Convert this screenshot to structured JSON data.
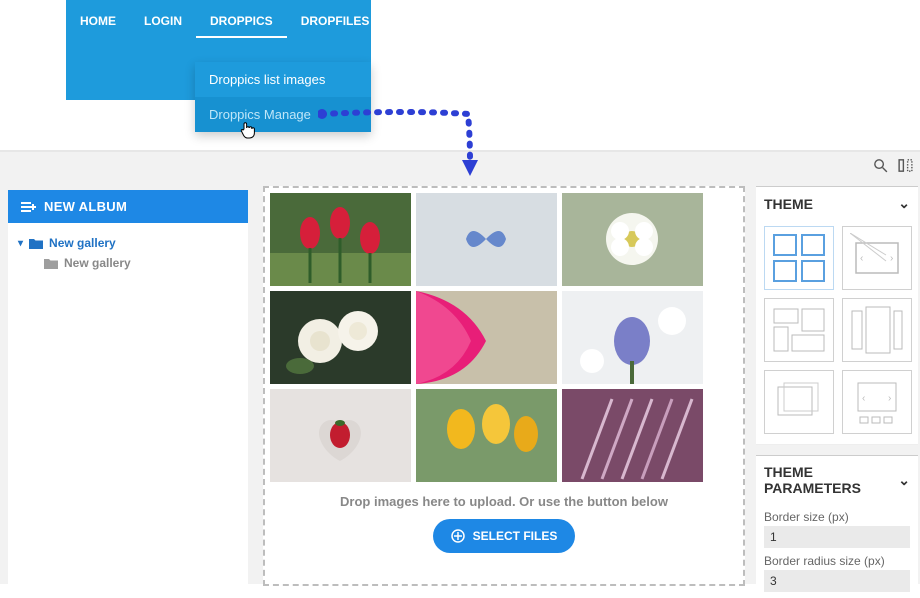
{
  "nav": {
    "items": [
      "HOME",
      "LOGIN",
      "DROPPICS",
      "DROPFILES"
    ],
    "active": "DROPPICS",
    "submenu": [
      "Droppics list images",
      "Droppics Manage"
    ]
  },
  "toolbar": {
    "search_icon": "search-icon",
    "split_icon": "split-icon"
  },
  "sidebar": {
    "new_album": "NEW ALBUM",
    "tree": [
      {
        "label": "New gallery",
        "level": 0,
        "color": "#2072c4"
      },
      {
        "label": "New gallery",
        "level": 1,
        "color": "#888"
      }
    ]
  },
  "gallery": {
    "drop_text": "Drop images here to upload. Or use the button below",
    "select_button": "SELECT FILES",
    "thumbs": [
      "red-tulips",
      "blue-butterfly",
      "white-blossom",
      "white-roses",
      "pink-flower",
      "spring-hyacinth",
      "strawberry-heart",
      "yellow-tulips",
      "ornamental-grass"
    ]
  },
  "theme": {
    "title": "THEME"
  },
  "theme_params": {
    "title": "THEME PARAMETERS",
    "fields": [
      {
        "label": "Border size (px)",
        "value": "1"
      },
      {
        "label": "Border radius size (px)",
        "value": "3"
      }
    ]
  }
}
